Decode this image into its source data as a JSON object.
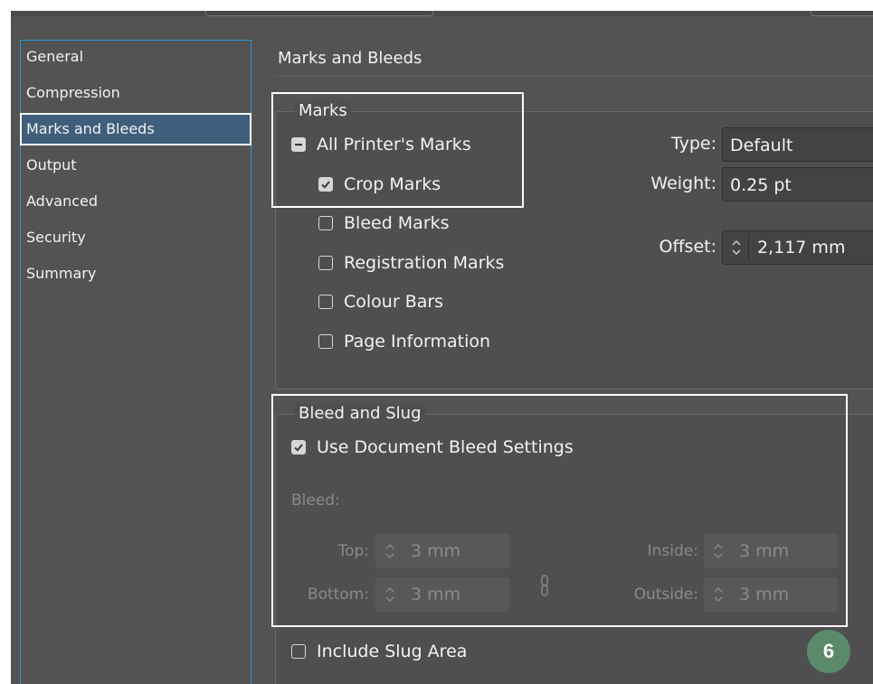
{
  "sidebar": {
    "items": [
      {
        "label": "General"
      },
      {
        "label": "Compression"
      },
      {
        "label": "Marks and Bleeds",
        "selected": true
      },
      {
        "label": "Output"
      },
      {
        "label": "Advanced"
      },
      {
        "label": "Security"
      },
      {
        "label": "Summary"
      }
    ]
  },
  "main": {
    "section_title": "Marks and Bleeds",
    "marks": {
      "legend": "Marks",
      "all_printers_marks": {
        "label": "All Printer's Marks",
        "state": "mixed"
      },
      "crop_marks": {
        "label": "Crop Marks",
        "checked": true
      },
      "bleed_marks": {
        "label": "Bleed Marks",
        "checked": false
      },
      "registration_marks": {
        "label": "Registration Marks",
        "checked": false
      },
      "colour_bars": {
        "label": "Colour Bars",
        "checked": false
      },
      "page_information": {
        "label": "Page Information",
        "checked": false
      },
      "type": {
        "label": "Type:",
        "value": "Default"
      },
      "weight": {
        "label": "Weight:",
        "value": "0.25 pt"
      },
      "offset": {
        "label": "Offset:",
        "value": "2,117 mm"
      }
    },
    "bleed_and_slug": {
      "legend": "Bleed and Slug",
      "use_document_bleed": {
        "label": "Use Document Bleed Settings",
        "checked": true
      },
      "bleed_label": "Bleed:",
      "top": {
        "label": "Top:",
        "value": "3 mm"
      },
      "bottom": {
        "label": "Bottom:",
        "value": "3 mm"
      },
      "inside": {
        "label": "Inside:",
        "value": "3 mm"
      },
      "outside": {
        "label": "Outside:",
        "value": "3 mm"
      },
      "include_slug": {
        "label": "Include Slug Area",
        "checked": false
      }
    }
  },
  "annotation": {
    "step_number": "6"
  },
  "colors": {
    "dialog_bg": "#535353",
    "selection_bg": "#3f5e7b",
    "focus_border": "#2f95d6",
    "badge_bg": "#5a8a6a",
    "highlight": "#ffffff"
  }
}
